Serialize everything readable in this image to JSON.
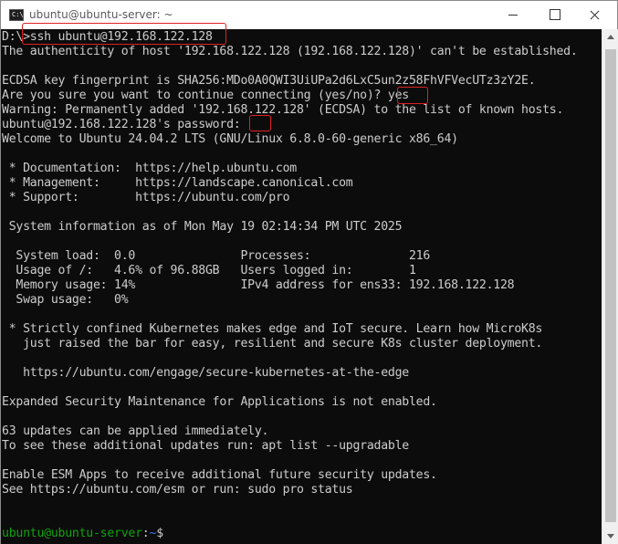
{
  "window": {
    "title": "ubuntu@ubuntu-server: ~",
    "icon_label": "C:\\."
  },
  "terminal": {
    "lines": [
      "D:\\>ssh ubuntu@192.168.122.128",
      "The authenticity of host '192.168.122.128 (192.168.122.128)' can't be established.",
      "",
      "ECDSA key fingerprint is SHA256:MDo0A0QWI3UiUPa2d6LxC5un2z58FhVFVecUTz3zY2E.",
      "Are you sure you want to continue connecting (yes/no)? yes",
      "Warning: Permanently added '192.168.122.128' (ECDSA) to the list of known hosts.",
      "ubuntu@192.168.122.128's password:",
      "Welcome to Ubuntu 24.04.2 LTS (GNU/Linux 6.8.0-60-generic x86_64)",
      "",
      " * Documentation:  https://help.ubuntu.com",
      " * Management:     https://landscape.canonical.com",
      " * Support:        https://ubuntu.com/pro",
      "",
      " System information as of Mon May 19 02:14:34 PM UTC 2025",
      "",
      "  System load:  0.0               Processes:              216",
      "  Usage of /:   4.6% of 96.88GB   Users logged in:        1",
      "  Memory usage: 14%               IPv4 address for ens33: 192.168.122.128",
      "  Swap usage:   0%",
      "",
      " * Strictly confined Kubernetes makes edge and IoT secure. Learn how MicroK8s",
      "   just raised the bar for easy, resilient and secure K8s cluster deployment.",
      "",
      "   https://ubuntu.com/engage/secure-kubernetes-at-the-edge",
      "",
      "Expanded Security Maintenance for Applications is not enabled.",
      "",
      "63 updates can be applied immediately.",
      "To see these additional updates run: apt list --upgradable",
      "",
      "Enable ESM Apps to receive additional future security updates.",
      "See https://ubuntu.com/esm or run: sudo pro status"
    ],
    "prompt": {
      "user_host": "ubuntu@ubuntu-server",
      "separator": ":",
      "path": "~",
      "symbol": "$"
    }
  },
  "colors": {
    "background": "#0c0c0c",
    "text": "#cccccc",
    "prompt_user": "#13a10e",
    "prompt_path": "#3b78ff",
    "highlight": "#e02020"
  }
}
